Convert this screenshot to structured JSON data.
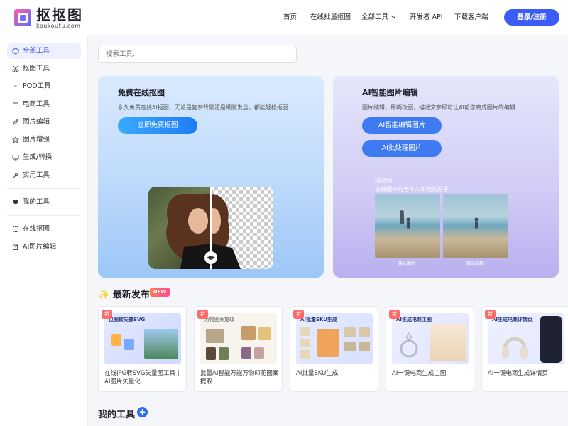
{
  "header": {
    "logo_text": "抠抠图",
    "logo_sub": "koukoutu.com",
    "nav": [
      "首页",
      "在线批量抠图",
      "全部工具",
      "开发者 API",
      "下载客户端"
    ],
    "login": "登录/注册"
  },
  "sidebar": {
    "items": [
      {
        "label": "全部工具",
        "icon": "box-icon"
      },
      {
        "label": "抠图工具",
        "icon": "scissors-icon"
      },
      {
        "label": "POD工具",
        "icon": "shirt-icon"
      },
      {
        "label": "电商工具",
        "icon": "shop-icon"
      },
      {
        "label": "图片编辑",
        "icon": "pen-icon"
      },
      {
        "label": "图片增强",
        "icon": "star-icon"
      },
      {
        "label": "生成/转换",
        "icon": "monitor-icon"
      },
      {
        "label": "实用工具",
        "icon": "wrench-icon"
      }
    ],
    "my_tools": "我的工具",
    "links": [
      {
        "label": "在线抠图",
        "icon": "cutout-icon"
      },
      {
        "label": "AI图片编辑",
        "icon": "edit-icon"
      }
    ]
  },
  "search": {
    "placeholder": "搜索工具..."
  },
  "hero_left": {
    "title": "免费在线抠图",
    "desc": "永久免费在线AI抠图，无论是复杂背景还是细腻发丝，都能轻松抠图.",
    "button": "立即免费抠图"
  },
  "hero_right": {
    "title": "AI智能图片编辑",
    "desc": "图片编辑，用嘴改图，描述文字即可让AI帮您完成图片的编辑.",
    "button1": "AI智能编辑图片",
    "button2": "AI批处理图片",
    "caption_line1": "描述词:",
    "caption_line2": "去掉图中的老年人和他的影子",
    "input_label": "输入图片",
    "output_label": "输出结果"
  },
  "latest": {
    "title": "最新发布",
    "badge": "NEW",
    "cards": [
      {
        "badge": "新",
        "thumb_title": "位图转矢量SVG",
        "name": "在线JPG转SVG矢量图工具 | AI图片矢量化"
      },
      {
        "badge": "新",
        "thumb_title": "万物图案提取",
        "name": "批量AI智能万能万物印花图案提取"
      },
      {
        "badge": "新",
        "thumb_title": "AI批量SKU生成",
        "name": "AI批量SKU生成"
      },
      {
        "badge": "新",
        "thumb_title": "AI生成电商主图",
        "name": "AI一键电商生成主图"
      },
      {
        "badge": "新",
        "thumb_title": "AI生成电商详情页",
        "name": "AI一键电商生成详情页"
      }
    ]
  },
  "my_tools": {
    "title": "我的工具",
    "plus": "+"
  },
  "colors": {
    "accent": "#3b5cf6",
    "new_badge": "#ff6b6b"
  }
}
